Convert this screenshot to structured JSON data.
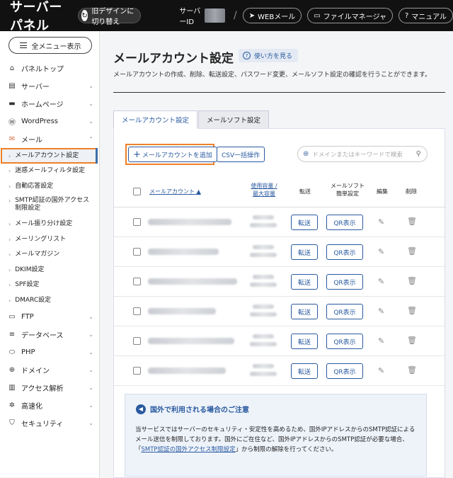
{
  "header": {
    "brand": "サーバーパネル",
    "old_design": "旧デザインに切り替え",
    "server_id_label": "サーバーID",
    "slash": "/",
    "webmail": "WEBメール",
    "file_manager": "ファイルマネージャ",
    "manual": "マニュアル"
  },
  "sidebar": {
    "all_menu": "全メニュー表示",
    "items": [
      {
        "label": "パネルトップ",
        "icon": "home-icon"
      },
      {
        "label": "サーバー",
        "icon": "server-icon"
      },
      {
        "label": "ホームページ",
        "icon": "homepage-icon"
      },
      {
        "label": "WordPress",
        "icon": "wordpress-icon"
      },
      {
        "label": "メール",
        "icon": "mail-icon"
      }
    ],
    "mail_sub": [
      "メールアカウント設定",
      "迷惑メールフィルタ設定",
      "自動応答設定",
      "SMTP認証の国外アクセス制限設定",
      "メール振り分け設定",
      "メーリングリスト",
      "メールマガジン",
      "DKIM設定",
      "SPF設定",
      "DMARC設定"
    ],
    "items2": [
      {
        "label": "FTP",
        "icon": "ftp-icon"
      },
      {
        "label": "データベース",
        "icon": "database-icon"
      },
      {
        "label": "PHP",
        "icon": "php-icon"
      },
      {
        "label": "ドメイン",
        "icon": "domain-icon"
      },
      {
        "label": "アクセス解析",
        "icon": "analytics-icon"
      },
      {
        "label": "高速化",
        "icon": "speed-icon"
      },
      {
        "label": "セキュリティ",
        "icon": "security-icon"
      }
    ]
  },
  "main": {
    "title": "メールアカウント設定",
    "help": "使い方を見る",
    "description": "メールアカウントの作成、削除、転送設定、パスワード変更、メールソフト設定の確認を行うことができます。",
    "tabs": [
      "メールアカウント設定",
      "メールソフト設定"
    ],
    "add_button": "メールアカウントを追加",
    "csv_button": "CSV一括操作",
    "search_placeholder": "ドメインまたはキーワードで検索",
    "table": {
      "col_account": "メールアカウント ▲",
      "col_usage_1": "使用容量 /",
      "col_usage_2": "最大容量",
      "col_forward": "転送",
      "col_mailsoft_1": "メールソフト",
      "col_mailsoft_2": "簡単設定",
      "col_edit": "編集",
      "col_delete": "削除",
      "forward_btn": "転送",
      "qr_btn": "QR表示",
      "row_count": 6
    },
    "notice": {
      "title": "国外で利用される場合のご注意",
      "body_1": "当サービスではサーバーのセキュリティ・安定性を高めるため、国外IPアドレスからのSMTP認証によるメール送信を制限しております。国外にご在住など、国外IPアドレスからのSMTP認証が必要な場合、「",
      "link": "SMTP認証の国外アクセス制限設定",
      "body_2": "」から制限の解除を行ってください。"
    }
  }
}
